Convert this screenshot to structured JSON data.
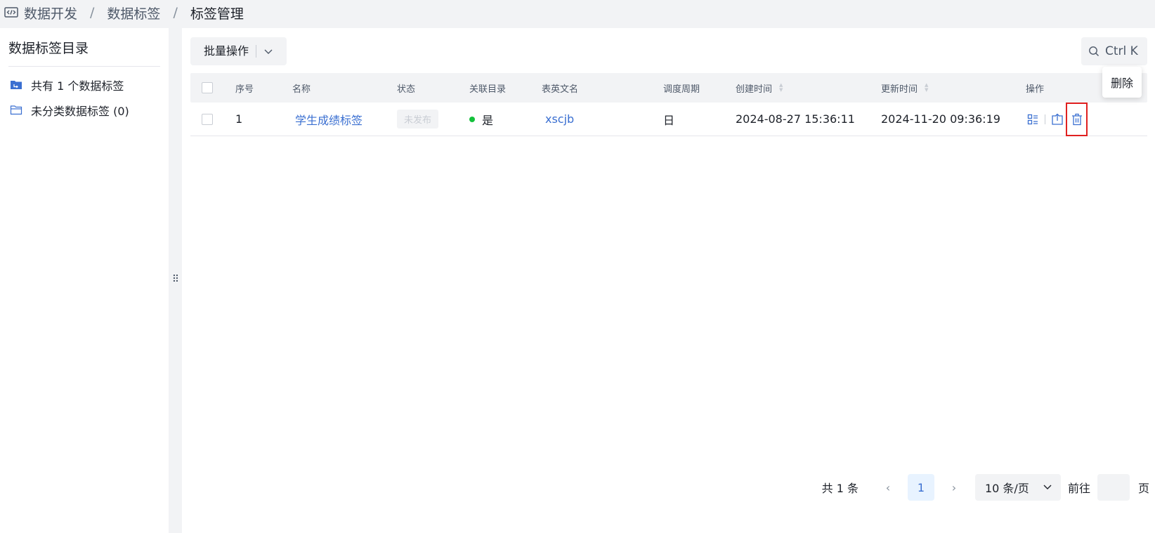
{
  "breadcrumb": {
    "icon": "code-window-icon",
    "items": [
      "数据开发",
      "数据标签",
      "标签管理"
    ],
    "separator": "/"
  },
  "sidebar": {
    "title": "数据标签目录",
    "items": [
      {
        "icon": "folder-filled-icon",
        "label": "共有 1 个数据标签"
      },
      {
        "icon": "folder-outline-icon",
        "label": "未分类数据标签 (0)"
      }
    ]
  },
  "toolbar": {
    "batch_label": "批量操作",
    "search_shortcut": "Ctrl K"
  },
  "table": {
    "columns": {
      "index": "序号",
      "name": "名称",
      "status": "状态",
      "linked_dir": "关联目录",
      "table_name": "表英文名",
      "schedule": "调度周期",
      "created": "创建时间",
      "updated": "更新时间",
      "actions": "操作"
    },
    "rows": [
      {
        "index": "1",
        "name": "学生成绩标签",
        "status": "未发布",
        "linked_dir": "是",
        "table_name": "xscjb",
        "schedule": "日",
        "created": "2024-08-27 15:36:11",
        "updated": "2024-11-20 09:36:19"
      }
    ]
  },
  "tooltip": {
    "text": "删除"
  },
  "pagination": {
    "total": "共 1 条",
    "current_page": "1",
    "page_size": "10 条/页",
    "goto_label": "前往",
    "page_suffix": "页"
  },
  "colors": {
    "accent": "#3a6fd1",
    "status_dot": "#13c13b",
    "highlight_border": "#e02020"
  }
}
